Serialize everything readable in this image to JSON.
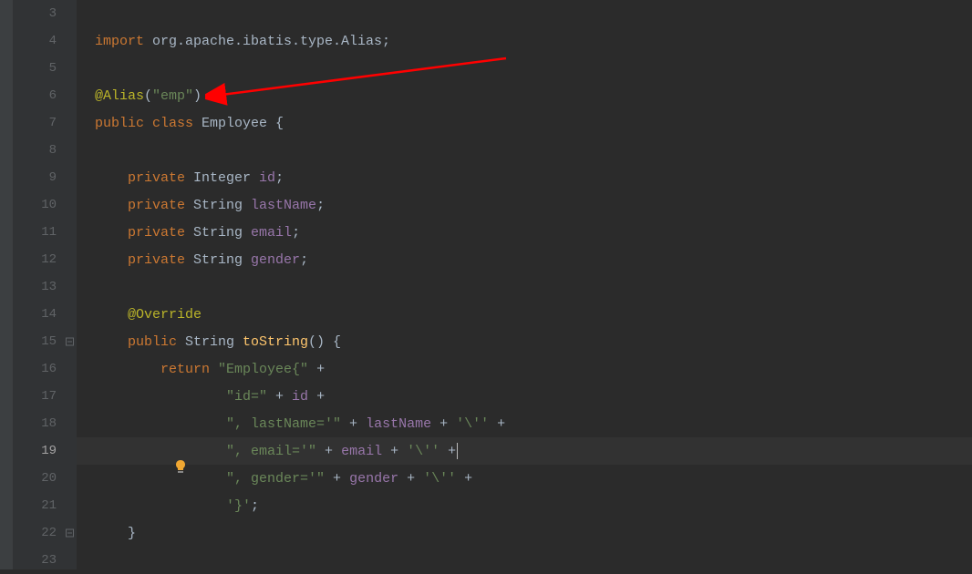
{
  "gutter": {
    "lines": [
      "3",
      "4",
      "5",
      "6",
      "7",
      "8",
      "9",
      "10",
      "11",
      "12",
      "13",
      "14",
      "15",
      "16",
      "17",
      "18",
      "19",
      "20",
      "21",
      "22",
      "23"
    ],
    "current_line_index": 16
  },
  "code": {
    "l3": "",
    "l4_import": "import",
    "l4_pkg": " org.apache.ibatis.type.Alias;",
    "l5": "",
    "l6_ann": "@Alias",
    "l6_paren1": "(",
    "l6_str": "\"emp\"",
    "l6_paren2": ")",
    "l7_public": "public",
    "l7_class": " class",
    "l7_name": " Employee ",
    "l7_brace": "{",
    "l8": "",
    "l9_private": "    private",
    "l9_type": " Integer ",
    "l9_name": "id",
    "l9_semi": ";",
    "l10_private": "    private",
    "l10_type": " String ",
    "l10_name": "lastName",
    "l10_semi": ";",
    "l11_private": "    private",
    "l11_type": " String ",
    "l11_name": "email",
    "l11_semi": ";",
    "l12_private": "    private",
    "l12_type": " String ",
    "l12_name": "gender",
    "l12_semi": ";",
    "l13": "",
    "l14_ann": "    @Override",
    "l15_public": "    public",
    "l15_type": " String ",
    "l15_method": "toString",
    "l15_rest": "() {",
    "l16_return": "        return",
    "l16_str": " \"Employee{\"",
    "l16_op": " +",
    "l17_str": "                \"id=\"",
    "l17_op": " + ",
    "l17_id": "id",
    "l17_op2": " +",
    "l18_str": "                \", lastName='\"",
    "l18_op": " + ",
    "l18_id": "lastName",
    "l18_op2": " + ",
    "l18_str2": "'\\''",
    "l18_op3": " +",
    "l19_str": "                \", email='\"",
    "l19_op": " + ",
    "l19_id": "email",
    "l19_op2": " + ",
    "l19_str2": "'\\''",
    "l19_op3": " +",
    "l20_str": "                \", gender='\"",
    "l20_op": " + ",
    "l20_id": "gender",
    "l20_op2": " + ",
    "l20_str2": "'\\''",
    "l20_op3": " +",
    "l21_str": "                '}'",
    "l21_semi": ";",
    "l22_brace": "    }",
    "l23": ""
  }
}
